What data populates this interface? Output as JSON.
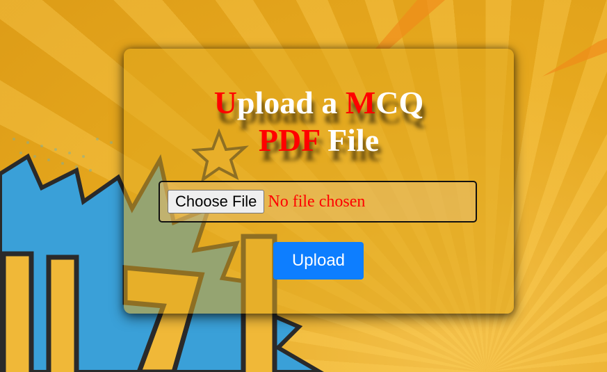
{
  "title": {
    "line1_first": "U",
    "line1_rest1": "pload a ",
    "line1_m": "M",
    "line1_rest2": "CQ",
    "line2_red": "PDF",
    "line2_rest": " File"
  },
  "file_input": {
    "button_label": "Choose File",
    "status": "No file chosen"
  },
  "upload_button": {
    "label": "Upload"
  },
  "background": {
    "letters": "IIZI",
    "colors": {
      "base": "#e8a91c",
      "burst": "#3aa0d8",
      "letter": "#f0b838"
    }
  },
  "colors": {
    "accent_red": "#ff0000",
    "button_blue": "#0d7eff"
  }
}
